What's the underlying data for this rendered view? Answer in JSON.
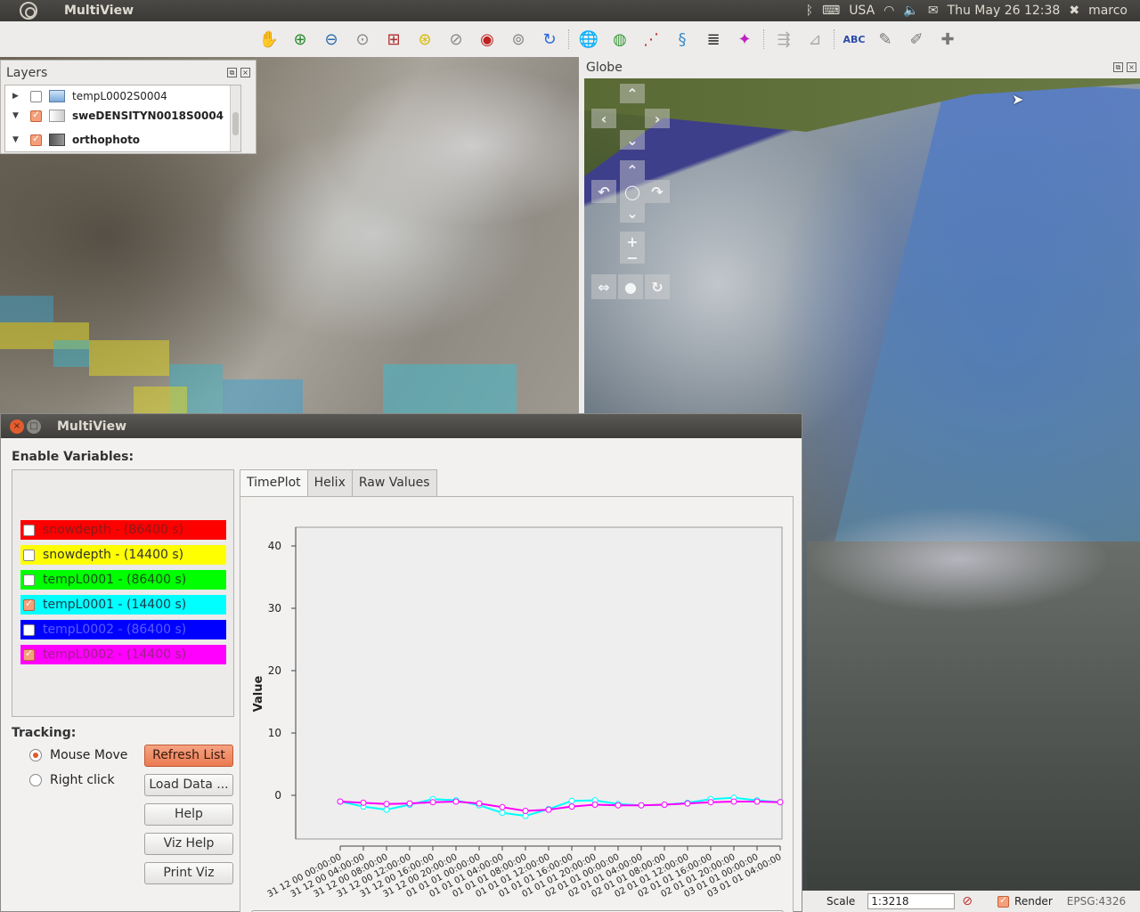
{
  "topbar": {
    "app_title": "MultiView",
    "keyboard_layout": "USA",
    "datetime": "Thu May 26 12:38",
    "user": "marco"
  },
  "layers_panel": {
    "title": "Layers",
    "layers": [
      {
        "name": "tempL0002S0004",
        "checked": false,
        "expanded": false,
        "bold": false
      },
      {
        "name": "sweDENSITYN0018S0004",
        "checked": true,
        "expanded": true,
        "bold": true
      },
      {
        "name": "orthophoto",
        "checked": true,
        "expanded": true,
        "bold": true
      }
    ]
  },
  "globe_panel": {
    "title": "Globe"
  },
  "statusbar": {
    "scale_label": "Scale",
    "scale_value": "1:3218",
    "render_label": "Render",
    "render_checked": true,
    "crs": "EPSG:4326"
  },
  "dialog": {
    "title": "MultiView",
    "enable_label": "Enable Variables:",
    "variables": [
      {
        "label": "snowdepth - (86400 s)",
        "color": "#ff0000",
        "checked": false
      },
      {
        "label": "snowdepth - (14400 s)",
        "color": "#ffff00",
        "checked": false
      },
      {
        "label": "tempL0001 - (86400 s)",
        "color": "#00ff00",
        "checked": false
      },
      {
        "label": "tempL0001 - (14400 s)",
        "color": "#00ffff",
        "checked": true
      },
      {
        "label": "tempL0002 - (86400 s)",
        "color": "#0000ff",
        "checked": false
      },
      {
        "label": "tempL0002 - (14400 s)",
        "color": "#ff00ff",
        "checked": true
      }
    ],
    "tracking_label": "Tracking:",
    "tracking_options": [
      {
        "label": "Mouse Move",
        "selected": true
      },
      {
        "label": "Right click",
        "selected": false
      }
    ],
    "buttons": {
      "refresh": "Refresh List",
      "load": "Load Data ...",
      "help": "Help",
      "viz_help": "Viz Help",
      "print_viz": "Print Viz"
    },
    "tabs": [
      {
        "label": "TimePlot",
        "active": true
      },
      {
        "label": "Helix",
        "active": false
      },
      {
        "label": "Raw Values",
        "active": false
      }
    ]
  },
  "chart_data": {
    "type": "line",
    "title": "",
    "xlabel": "",
    "ylabel": "Value",
    "ylim": [
      -7,
      43
    ],
    "yticks": [
      0,
      10,
      20,
      30,
      40
    ],
    "grid": false,
    "x": [
      "31 12 00 00:00:00",
      "31 12 00 04:00:00",
      "31 12 00 08:00:00",
      "31 12 00 12:00:00",
      "31 12 00 16:00:00",
      "31 12 00 20:00:00",
      "01 01 01 00:00:00",
      "01 01 01 04:00:00",
      "01 01 01 08:00:00",
      "01 01 01 12:00:00",
      "01 01 01 16:00:00",
      "01 01 01 20:00:00",
      "02 01 01 00:00:00",
      "02 01 01 04:00:00",
      "02 01 01 08:00:00",
      "02 01 01 12:00:00",
      "02 01 01 16:00:00",
      "02 01 01 20:00:00",
      "03 01 01 00:00:00",
      "03 01 01 04:00:00"
    ],
    "series": [
      {
        "name": "tempL0001 - (14400 s)",
        "color": "#00ffff",
        "values": [
          -1.0,
          -1.8,
          -2.3,
          -1.5,
          -0.6,
          -0.8,
          -1.6,
          -2.8,
          -3.3,
          -2.2,
          -0.9,
          -0.8,
          -1.4,
          -1.6,
          -1.5,
          -1.2,
          -0.6,
          -0.4,
          -0.8,
          -1.1
        ]
      },
      {
        "name": "tempL0002 - (14400 s)",
        "color": "#ff00ff",
        "values": [
          -1.0,
          -1.2,
          -1.4,
          -1.3,
          -1.1,
          -1.0,
          -1.3,
          -1.9,
          -2.5,
          -2.3,
          -1.8,
          -1.5,
          -1.6,
          -1.6,
          -1.5,
          -1.3,
          -1.1,
          -1.0,
          -1.0,
          -1.1
        ]
      }
    ]
  }
}
